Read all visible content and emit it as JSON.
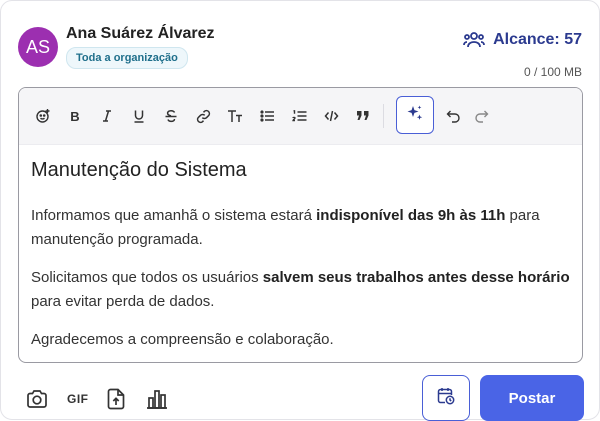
{
  "author": {
    "initials": "AS",
    "name": "Ana Suárez Álvarez",
    "audience": "Toda a organização",
    "avatar_color": "#9c2fb0"
  },
  "reach": {
    "label": "Alcance: 57"
  },
  "storage": {
    "usage": "0 / 100 MB"
  },
  "toolbar": {
    "icons": [
      "emoji-add-icon",
      "bold-icon",
      "italic-icon",
      "underline-icon",
      "strikethrough-icon",
      "link-icon",
      "text-size-icon",
      "bullet-list-icon",
      "numbered-list-icon",
      "code-icon",
      "quote-icon",
      "ai-sparkle-icon",
      "undo-icon",
      "redo-icon"
    ],
    "gif_label": "GIF"
  },
  "editor": {
    "title": "Manutenção do Sistema",
    "p1_before": "Informamos que amanhã o sistema estará ",
    "p1_bold": "indisponível das 9h às 11h",
    "p1_after": " para manutenção programada.",
    "p2_before": "Solicitamos que todos os usuários ",
    "p2_bold": "salvem seus trabalhos antes desse horário",
    "p2_after": " para evitar perda de dados.",
    "p3": "Agradecemos a compreensão e colaboração."
  },
  "actions": {
    "post_label": "Postar"
  },
  "colors": {
    "accent": "#4a64e6",
    "accent_dark": "#2b3a8f",
    "badge_bg": "#eef7fb",
    "badge_text": "#1f6f8b"
  }
}
